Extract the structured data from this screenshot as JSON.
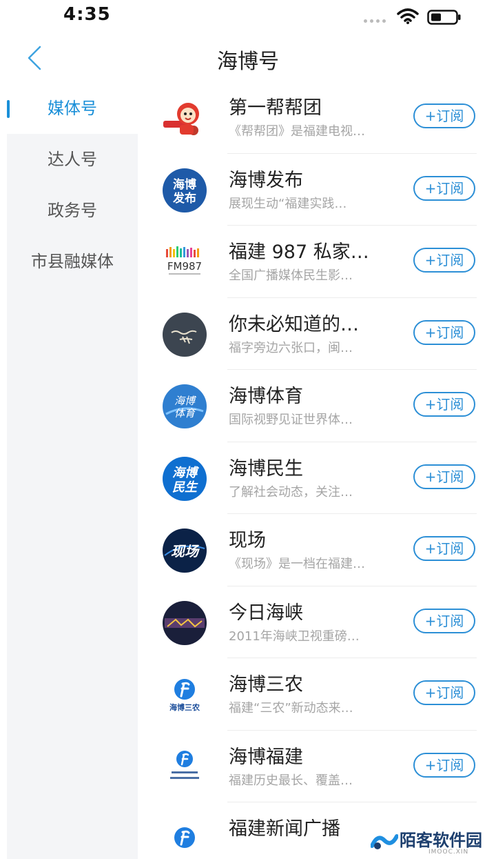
{
  "status_bar": {
    "time": "4:35"
  },
  "header": {
    "title": "海博号"
  },
  "sidebar": {
    "items": [
      {
        "label": "媒体号",
        "active": true
      },
      {
        "label": "达人号",
        "active": false
      },
      {
        "label": "政务号",
        "active": false
      },
      {
        "label": "市县融媒体",
        "active": false
      }
    ]
  },
  "list": {
    "subscribe_label": "+订阅",
    "items": [
      {
        "title": "第一帮帮团",
        "desc": "《帮帮团》是福建电视…",
        "icon": "bangbangtuan-mascot-icon"
      },
      {
        "title": "海博发布",
        "desc": "展现生动“福建实践…",
        "icon": "haibo-fabu-logo",
        "logo_text_1": "海博",
        "logo_text_2": "发布"
      },
      {
        "title": "福建 987 私家…",
        "desc": "全国广播媒体民生影…",
        "icon": "fm987-logo",
        "logo_text_1": "FM987"
      },
      {
        "title": "你未必知道的…",
        "desc": "福字旁边六张口，闽…",
        "icon": "fujian-calligraphy-logo"
      },
      {
        "title": "海博体育",
        "desc": "国际视野见证世界体…",
        "icon": "haibo-tiyu-logo",
        "logo_text_1": "海博",
        "logo_text_2": "体育"
      },
      {
        "title": "海博民生",
        "desc": "了解社会动态，关注…",
        "icon": "haibo-minsheng-logo",
        "logo_text_1": "海博",
        "logo_text_2": "民生"
      },
      {
        "title": "现场",
        "desc": "《现场》是一档在福建…",
        "icon": "xianchang-logo",
        "logo_text_1": "现场"
      },
      {
        "title": "今日海峡",
        "desc": "2011年海峡卫视重磅…",
        "icon": "jinri-haixia-logo"
      },
      {
        "title": "海博三农",
        "desc": "福建“三农”新动态来…",
        "icon": "haibo-sannong-logo",
        "logo_text_1": "海博三农"
      },
      {
        "title": "海博福建",
        "desc": "福建历史最长、覆盖…",
        "icon": "haibo-fujian-logo"
      },
      {
        "title": "福建新闻广播",
        "desc": "",
        "icon": "fujian-news-radio-logo"
      }
    ]
  },
  "watermark": {
    "text": "陌客软件园",
    "sub": "IMOOC.XIN"
  },
  "colors": {
    "accent": "#1a8fd8",
    "sidebar_bg": "#f4f5f7",
    "button_border": "#2c8fd6"
  }
}
